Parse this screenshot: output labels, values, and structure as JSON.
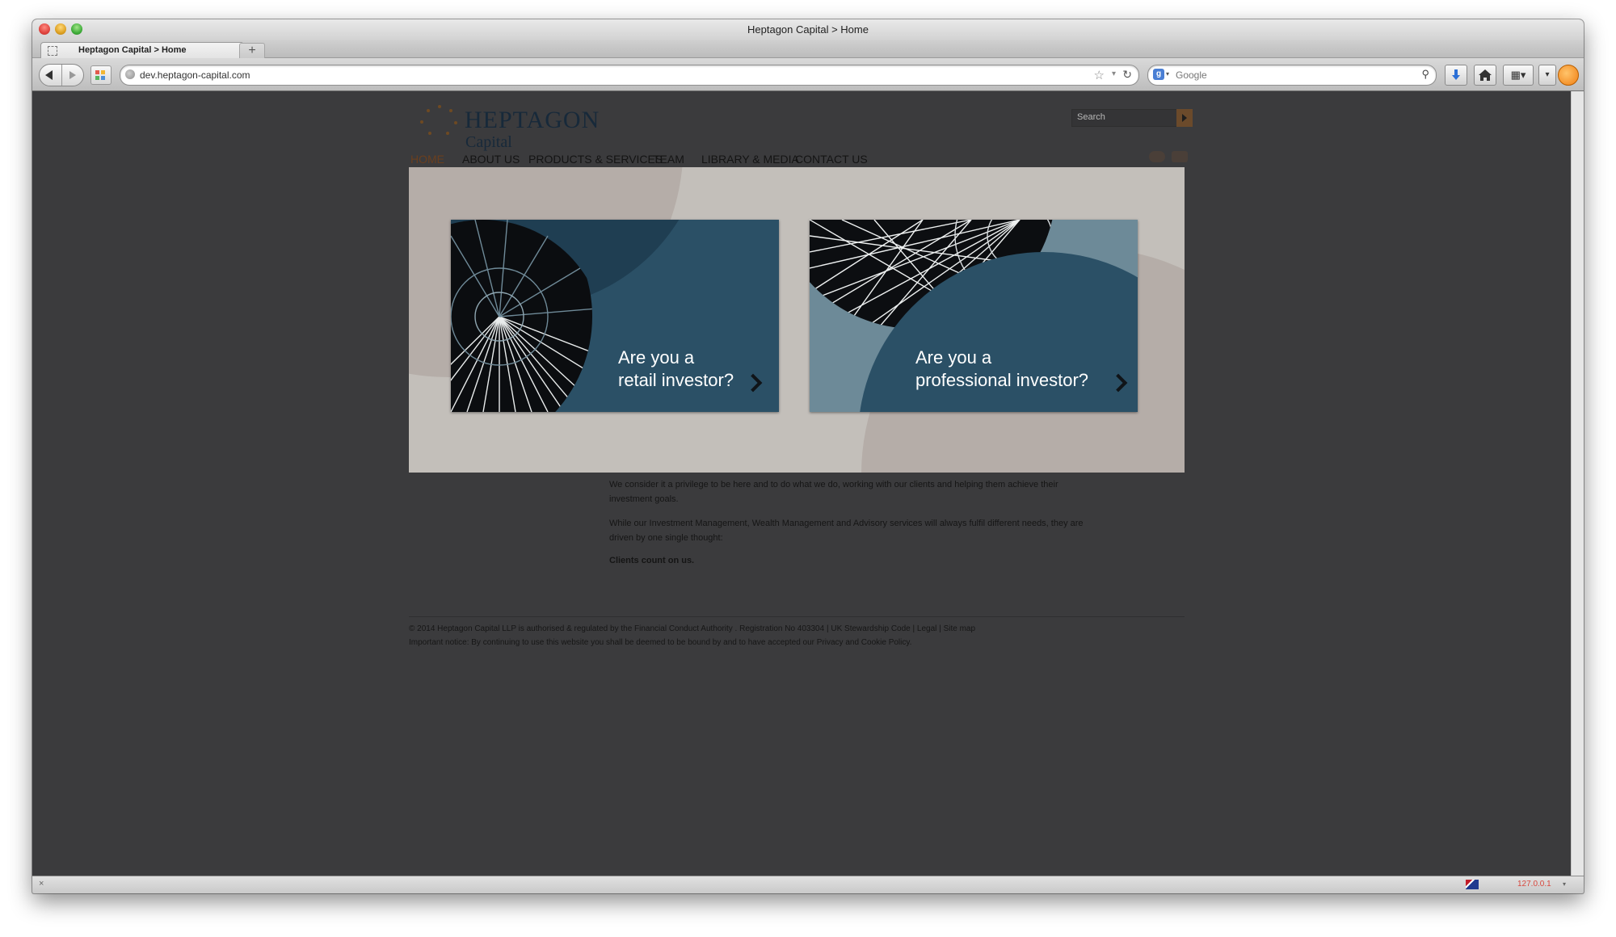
{
  "window": {
    "title": "Heptagon Capital > Home"
  },
  "tabs": [
    {
      "label": "Heptagon Capital > Home"
    }
  ],
  "newtab_label": "+",
  "address_bar": {
    "url": "dev.heptagon-capital.com"
  },
  "search_bar": {
    "engine_letter": "g",
    "placeholder": "Google"
  },
  "site": {
    "logo": {
      "main": "HEPTAGON",
      "sub": "Capital"
    },
    "search": {
      "placeholder": "Search"
    },
    "nav": [
      {
        "label": "HOME",
        "active": true
      },
      {
        "label": "ABOUT US",
        "active": false
      },
      {
        "label": "PRODUCTS & SERVICES",
        "active": false
      },
      {
        "label": "TEAM",
        "active": false
      },
      {
        "label": "LIBRARY & MEDIA",
        "active": false
      },
      {
        "label": "CONTACT US",
        "active": false
      }
    ],
    "cards": [
      {
        "line1": "Are you a",
        "line2": "retail investor?"
      },
      {
        "line1": "Are you a",
        "line2": "professional investor?"
      }
    ],
    "content": {
      "para1_line1": "We consider it a privilege to be here and to do what we do, working with our clients and helping them achieve their",
      "para1_line2": "investment goals.",
      "para2_line1": "While our Investment Management, Wealth Management and Advisory services will always fulfil different needs, they are",
      "para2_line2": "driven by one single thought:",
      "tagline": "Clients count on us."
    },
    "footer": {
      "copyright": "© 2014 Heptagon Capital LLP is authorised & regulated by the Financial Conduct Authority . Registration No 403304",
      "stewardship": "UK Stewardship Code",
      "legal": "Legal",
      "sitemap": "Site map",
      "notice": "Important notice: By continuing to use this website you shall be deemed to be bound by and to have accepted our Privacy and Cookie Policy."
    }
  },
  "statusbar": {
    "close_glyph": "×",
    "ip": "127.0.0.1",
    "caret": "▾"
  },
  "colors": {
    "page_bg": "#3b3b3d",
    "overlay_bg": "#c3bfba",
    "card_blue": "#2b5066",
    "card_light": "#6d8a98",
    "brand_brown": "#6a3f1f",
    "logo_navy": "#17293a"
  },
  "icons": {
    "back": "back-arrow-icon",
    "forward": "forward-arrow-icon",
    "bookmark": "star-icon",
    "reload": "reload-icon",
    "search": "magnifier-icon",
    "download": "download-icon",
    "home": "home-icon",
    "addon": "addon-icon",
    "tools": "tools-icon",
    "ghostery": "ghostery-icon",
    "card_arrow": "chevron-right-icon"
  }
}
